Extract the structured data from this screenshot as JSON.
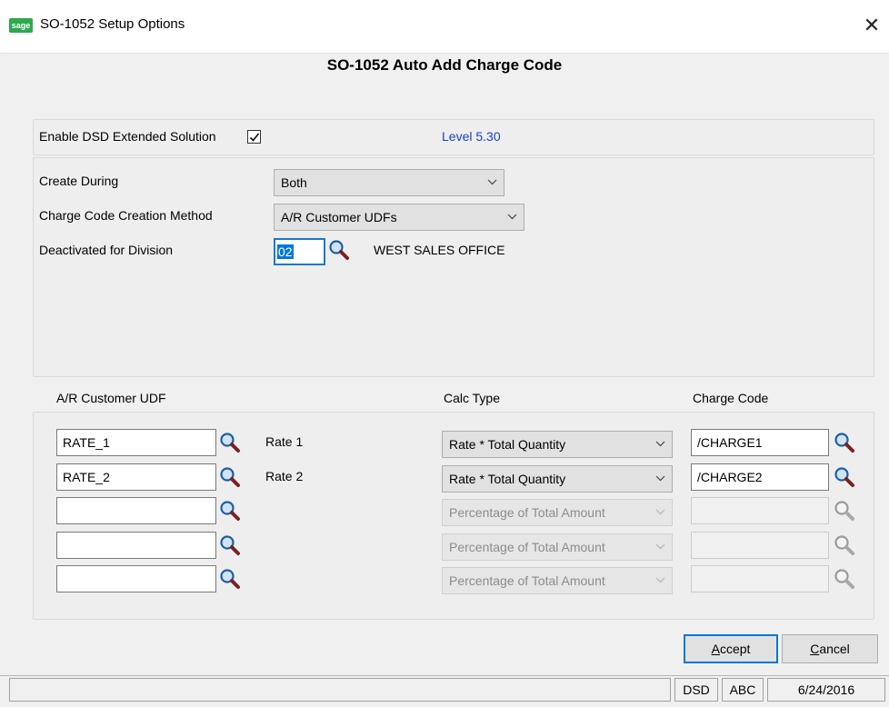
{
  "window": {
    "title": "SO-1052 Setup Options",
    "logo_text": "sage",
    "close_glyph": "✕"
  },
  "heading": "SO-1052 Auto Add Charge Code",
  "enable": {
    "label": "Enable DSD Extended Solution",
    "checked": true,
    "level": "Level  5.30"
  },
  "settings": {
    "create_during_label": "Create During",
    "create_during_value": "Both",
    "method_label": "Charge Code Creation Method",
    "method_value": "A/R Customer UDFs",
    "deactivated_label": "Deactivated for Division",
    "deactivated_value": "02",
    "division_name": "WEST SALES OFFICE"
  },
  "grid": {
    "udf_header": "A/R Customer UDF",
    "calc_header": "Calc Type",
    "charge_header": "Charge Code",
    "rows": [
      {
        "udf": "RATE_1",
        "desc": "Rate 1",
        "calc": "Rate * Total Quantity",
        "charge": "/CHARGE1",
        "enabled": true
      },
      {
        "udf": "RATE_2",
        "desc": "Rate 2",
        "calc": "Rate * Total Quantity",
        "charge": "/CHARGE2",
        "enabled": true
      },
      {
        "udf": "",
        "desc": "",
        "calc": "Percentage of Total Amount",
        "charge": "",
        "enabled": false
      },
      {
        "udf": "",
        "desc": "",
        "calc": "Percentage of Total Amount",
        "charge": "",
        "enabled": false
      },
      {
        "udf": "",
        "desc": "",
        "calc": "Percentage of Total Amount",
        "charge": "",
        "enabled": false
      }
    ]
  },
  "buttons": {
    "accept_mnemonic": "A",
    "accept_rest": "ccept",
    "cancel_mnemonic": "C",
    "cancel_rest": "ancel"
  },
  "status": {
    "company_code": "DSD",
    "user": "ABC",
    "date": "6/24/2016"
  },
  "colors": {
    "accent": "#0078d7",
    "level_text": "#1a3fd0",
    "sage_green": "#2fa84f"
  }
}
